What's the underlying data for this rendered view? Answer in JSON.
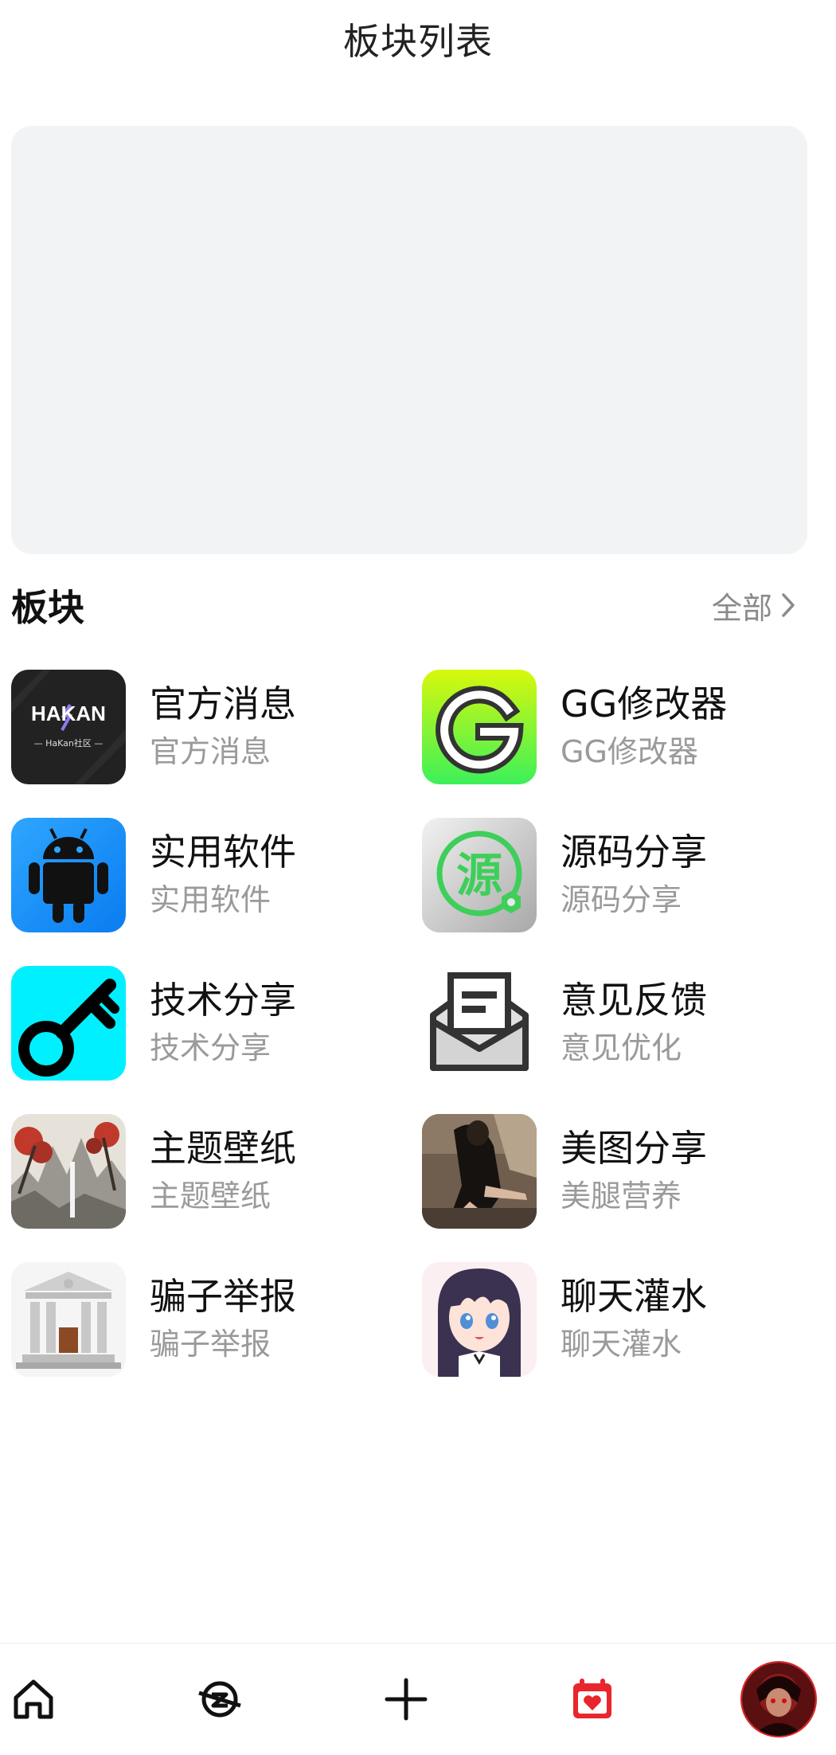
{
  "header": {
    "title": "板块列表"
  },
  "section": {
    "title": "板块",
    "view_all_label": "全部"
  },
  "boards": [
    {
      "name": "官方消息",
      "desc": "官方消息",
      "icon": "hakan-logo-icon"
    },
    {
      "name": "GG修改器",
      "desc": "GG修改器",
      "icon": "gg-logo-icon"
    },
    {
      "name": "实用软件",
      "desc": "实用软件",
      "icon": "android-robot-icon"
    },
    {
      "name": "源码分享",
      "desc": "源码分享",
      "icon": "source-badge-icon"
    },
    {
      "name": "技术分享",
      "desc": "技术分享",
      "icon": "key-icon"
    },
    {
      "name": "意见反馈",
      "desc": "意见优化",
      "icon": "mail-envelope-icon"
    },
    {
      "name": "主题壁纸",
      "desc": "主题壁纸",
      "icon": "landscape-painting-icon"
    },
    {
      "name": "美图分享",
      "desc": "美腿营养",
      "icon": "photo-thumbnail-icon"
    },
    {
      "name": "骗子举报",
      "desc": "骗子举报",
      "icon": "courthouse-icon"
    },
    {
      "name": "聊天灌水",
      "desc": "聊天灌水",
      "icon": "anime-girl-icon"
    }
  ],
  "icon_text": {
    "hakan": "HAKAN",
    "hakan_sub": "— HaKan社区 —",
    "source": "源"
  },
  "tabbar": {
    "items": [
      "home-icon",
      "discover-icon",
      "plus-icon",
      "calendar-heart-icon",
      "user-avatar"
    ],
    "active": "calendar-heart-icon"
  },
  "colors": {
    "accent": "#e8262c",
    "muted": "#9a9a9a",
    "banner_bg": "#f2f3f5"
  }
}
